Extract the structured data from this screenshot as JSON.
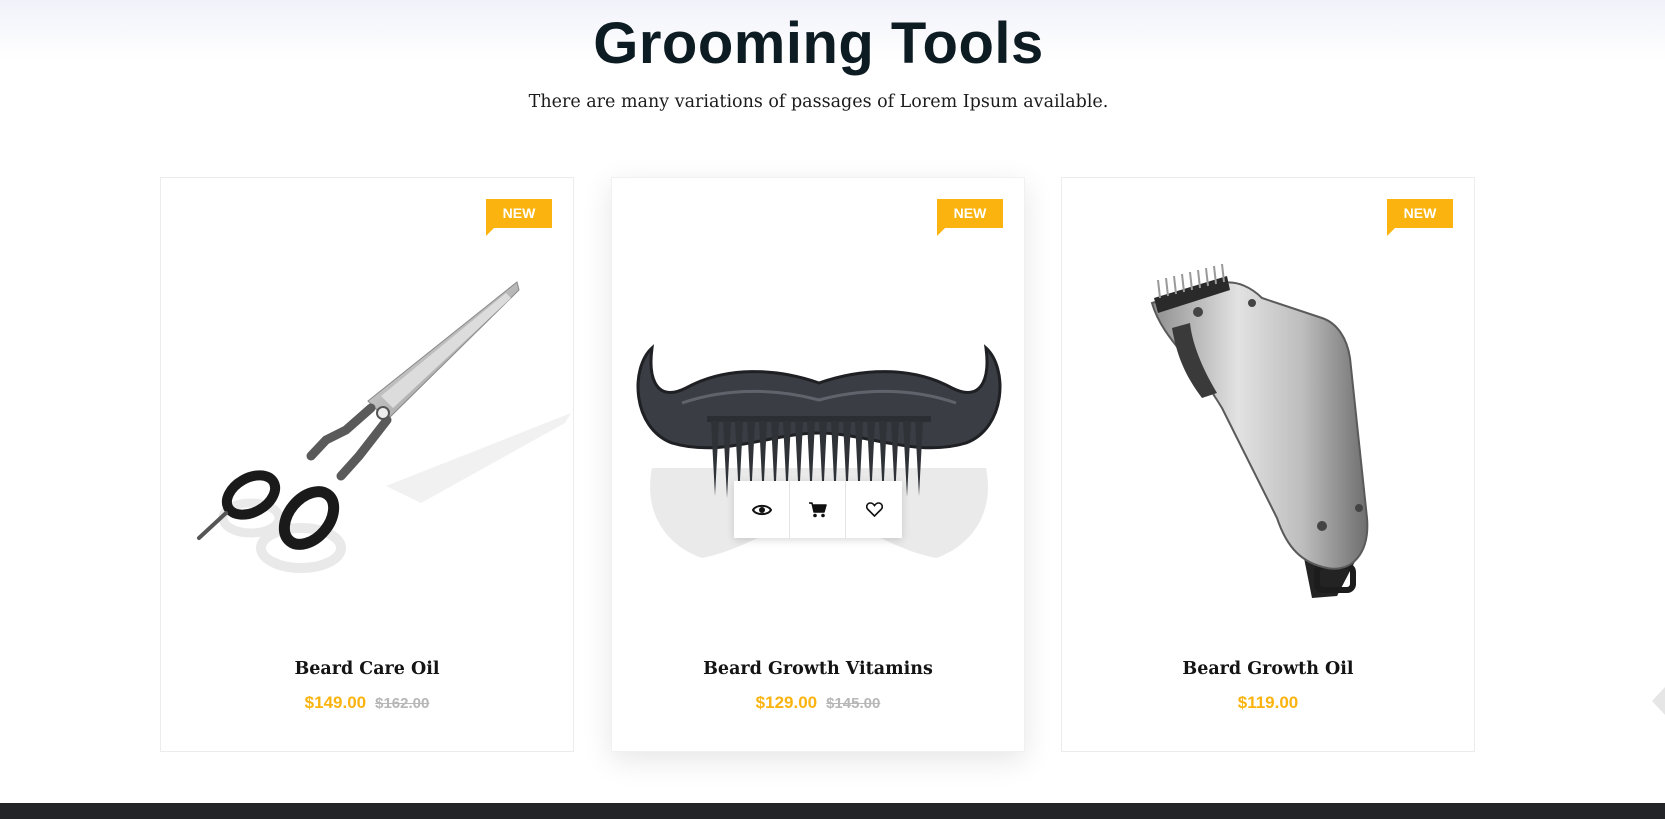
{
  "section": {
    "title": "Grooming Tools",
    "subtitle": "There are many variations of passages of Lorem Ipsum available."
  },
  "products": [
    {
      "name": "Beard Care Oil",
      "price": "$149.00",
      "old_price": "$162.00",
      "badge": "NEW",
      "image_icon": "scissors-image"
    },
    {
      "name": "Beard Growth Vitamins",
      "price": "$129.00",
      "old_price": "$145.00",
      "badge": "NEW",
      "image_icon": "mustache-comb-image"
    },
    {
      "name": "Beard Growth Oil",
      "price": "$119.00",
      "badge": "NEW",
      "image_icon": "hair-clipper-image"
    }
  ],
  "actions": [
    "quick-view-eye-icon",
    "add-to-cart-icon",
    "wishlist-heart-icon"
  ],
  "colors": {
    "accent": "#fbb40f",
    "title": "#0d1b22",
    "old_price": "#b7b7b7"
  }
}
